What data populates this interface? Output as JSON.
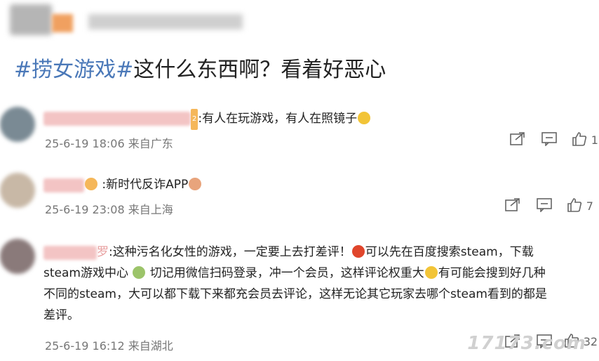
{
  "post": {
    "title_tag": "#捞女游戏#",
    "title_text": "这什么东西啊？看着好恶心"
  },
  "comments": [
    {
      "badge": "2",
      "text": ":有人在玩游戏，有人在照镜子",
      "time": "25-6-19 18:06 来自广东",
      "likes": "1"
    },
    {
      "text": ":新时代反诈APP",
      "time": "25-6-19 23:08 来自上海",
      "likes": "7"
    },
    {
      "name_suffix": "罗",
      "line1a": ":这种污名化女性的游戏，一定要上去打差评！",
      "line1b": "可以先在百度搜索steam，下载",
      "line2a": "steam游戏中心",
      "line2b": "切记用微信扫码登录，冲一个会员，这样评论权重大",
      "line2c": "有可能会搜到好几种",
      "line3": "不同的steam，大可以都下载下来都充会员去评论，这样无论其它玩家去哪个steam看到的都是",
      "line4": "差评。",
      "time": "25-6-19 16:12 来自湖北",
      "likes": "32"
    }
  ],
  "watermark": "17173.com",
  "icons": [
    "share-icon",
    "comment-icon",
    "like-icon"
  ]
}
